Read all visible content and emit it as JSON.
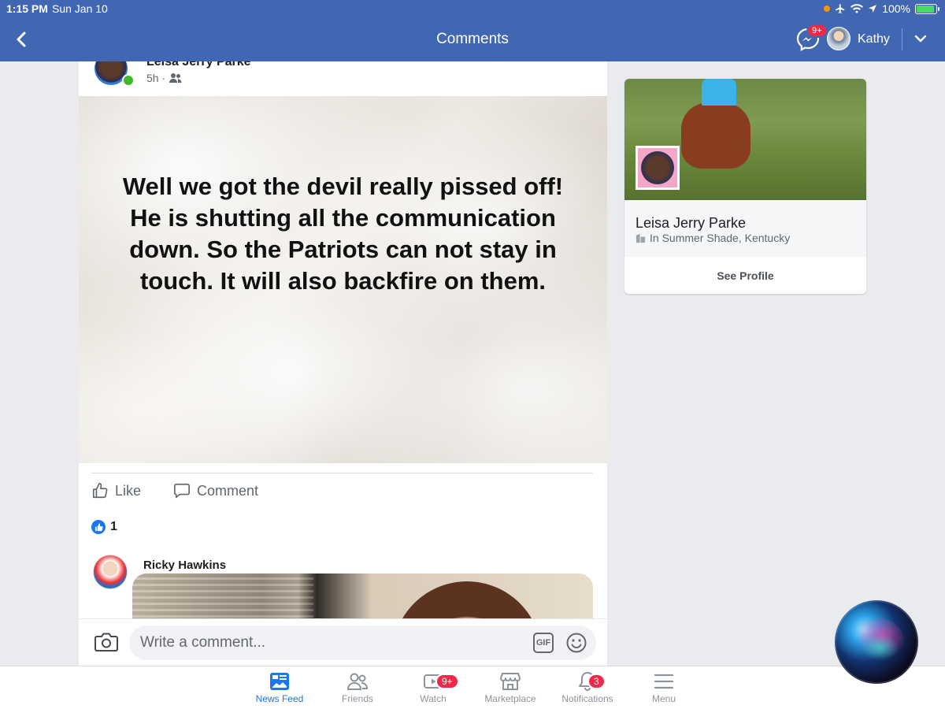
{
  "status_bar": {
    "time": "1:15 PM",
    "date": "Sun Jan 10",
    "battery": "100%"
  },
  "header": {
    "title": "Comments",
    "messenger_badge": "9+",
    "user_name": "Kathy"
  },
  "post": {
    "author": "Leisa Jerry Parke",
    "time": "5h ·",
    "text": "Well we got the devil really pissed off!\nHe is shutting all the communication down. So the Patriots can not stay in touch. It will also backfire on them.",
    "like_label": "Like",
    "comment_label": "Comment",
    "reaction_count": "1"
  },
  "comments": [
    {
      "author": "Ricky Hawkins"
    }
  ],
  "comment_box": {
    "placeholder": "Write a comment...",
    "gif_label": "GIF"
  },
  "profile_card": {
    "name": "Leisa Jerry Parke",
    "location": "In Summer Shade, Kentucky",
    "button": "See Profile"
  },
  "tabbar": {
    "items": [
      {
        "label": "News Feed",
        "icon": "news-feed-icon",
        "active": true
      },
      {
        "label": "Friends",
        "icon": "friends-icon"
      },
      {
        "label": "Watch",
        "icon": "watch-icon",
        "badge": "9+"
      },
      {
        "label": "Marketplace",
        "icon": "marketplace-icon"
      },
      {
        "label": "Notifications",
        "icon": "bell-icon",
        "badge": "3"
      },
      {
        "label": "Menu",
        "icon": "menu-icon"
      }
    ]
  },
  "colors": {
    "brand": "#4267b2",
    "accent": "#1877f2",
    "badge": "#f02849",
    "online": "#42b72a"
  }
}
